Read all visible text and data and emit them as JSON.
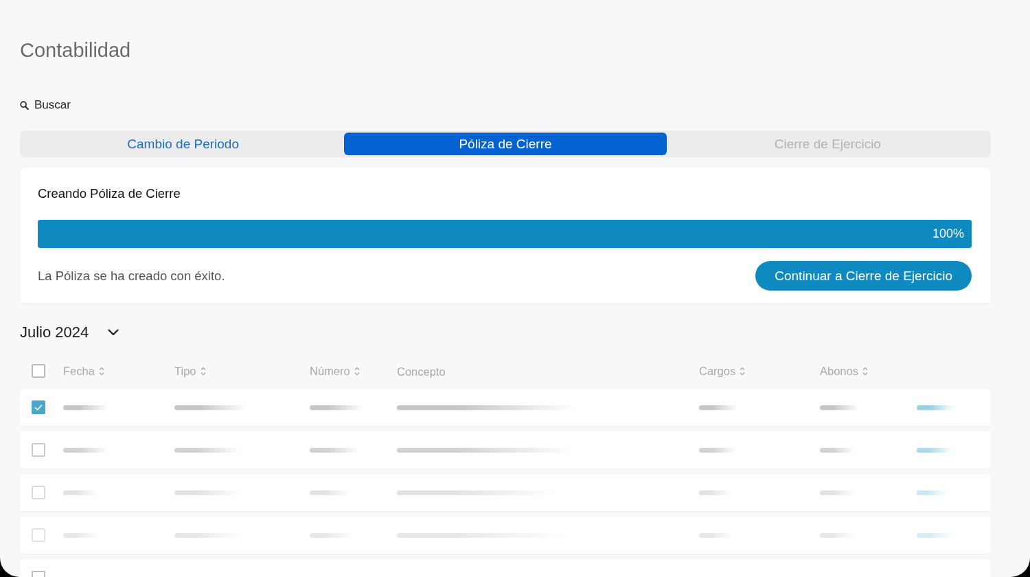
{
  "page": {
    "title": "Contabilidad"
  },
  "search": {
    "label": "Buscar"
  },
  "tabs": [
    {
      "label": "Cambio de Periodo",
      "selected": false,
      "disabled": false
    },
    {
      "label": "Póliza de Cierre",
      "selected": true,
      "disabled": false
    },
    {
      "label": "Cierre de Ejercicio",
      "selected": false,
      "disabled": true
    }
  ],
  "progress_card": {
    "title": "Creando Póliza de Cierre",
    "level": 1,
    "reading": "100%",
    "message": "La Póliza se ha creado con éxito.",
    "button": "Continuar a Cierre de Ejercicio"
  },
  "period": {
    "label": "Julio 2024"
  },
  "table": {
    "select_all": {
      "checked": false
    },
    "columns": [
      {
        "label": "Fecha",
        "sortable": true
      },
      {
        "label": "Tipo",
        "sortable": true
      },
      {
        "label": "Número",
        "sortable": true
      },
      {
        "label": "Concepto",
        "sortable": false
      },
      {
        "label": "Cargos",
        "sortable": true
      },
      {
        "label": "Abonos",
        "sortable": true
      }
    ],
    "rows": [
      {
        "checked": true
      },
      {
        "checked": false
      },
      {
        "checked": false
      },
      {
        "checked": false
      },
      {
        "checked": false
      }
    ]
  }
}
